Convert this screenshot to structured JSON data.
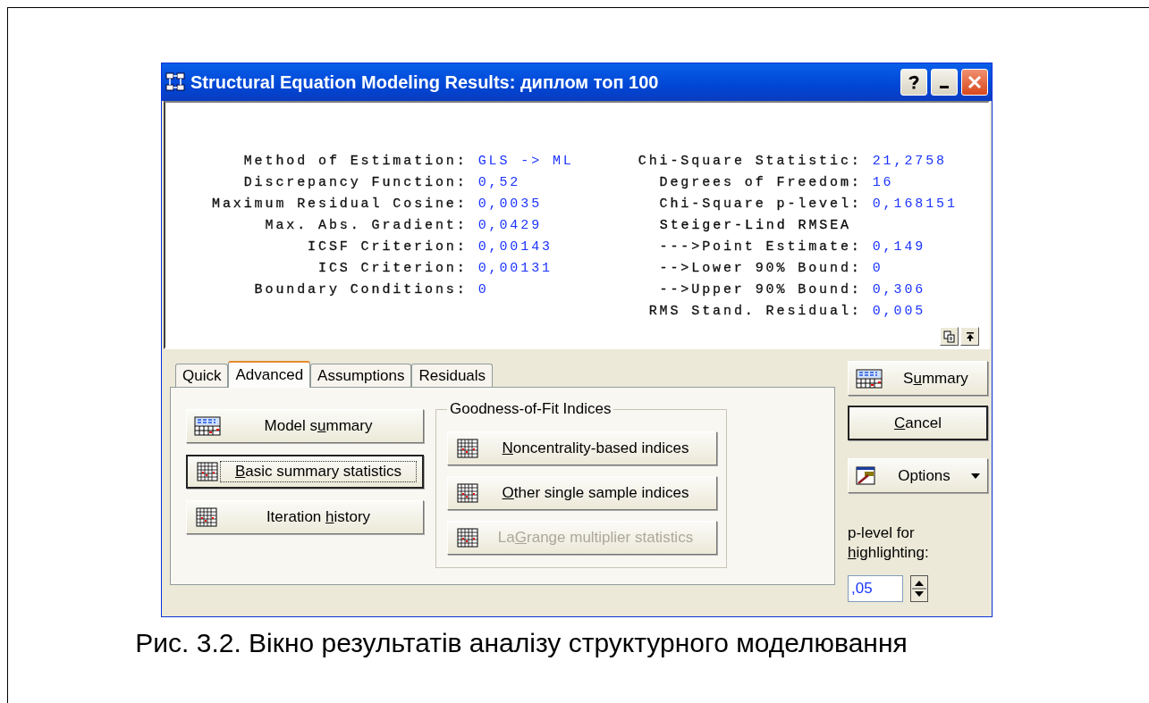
{
  "window": {
    "title": "Structural Equation Modeling Results: диплом топ 100"
  },
  "results": {
    "left": [
      {
        "kind": "row",
        "label": "Method of Estimation:",
        "value": "GLS -> ML"
      },
      {
        "kind": "row",
        "label": "Discrepancy Function:",
        "value": "0,52"
      },
      {
        "kind": "row",
        "label": "Maximum Residual Cosine:",
        "value": "0,0035"
      },
      {
        "kind": "row",
        "label": "Max. Abs. Gradient:",
        "value": "0,0429"
      },
      {
        "kind": "row",
        "label": "ICSF Criterion:",
        "value": "0,00143"
      },
      {
        "kind": "row",
        "label": "ICS Criterion:",
        "value": "0,00131"
      },
      {
        "kind": "row",
        "label": "Boundary Conditions:",
        "value": "0"
      }
    ],
    "right": [
      {
        "kind": "row",
        "label": "Chi-Square Statistic:",
        "value": "21,2758"
      },
      {
        "kind": "row",
        "label": "Degrees of Freedom:",
        "value": "16"
      },
      {
        "kind": "row",
        "label": "Chi-Square p-level:",
        "value": "0,168151"
      },
      {
        "kind": "heading",
        "label": "Steiger-Lind RMSEA"
      },
      {
        "kind": "row",
        "label": "--->Point Estimate:",
        "value": "0,149"
      },
      {
        "kind": "row",
        "label": "-->Lower 90% Bound:",
        "value": "0"
      },
      {
        "kind": "row",
        "label": "-->Upper 90% Bound:",
        "value": "0,306"
      },
      {
        "kind": "row",
        "label": "RMS Stand. Residual:",
        "value": "0,005"
      }
    ]
  },
  "tabs": [
    {
      "label": "Quick",
      "selected": false
    },
    {
      "label": "Advanced",
      "selected": true
    },
    {
      "label": "Assumptions",
      "selected": false
    },
    {
      "label": "Residuals",
      "selected": false
    }
  ],
  "action_buttons": [
    {
      "kind": "summary",
      "label": {
        "before": "Model s",
        "key": "u",
        "after": "mmary"
      },
      "focused": false
    },
    {
      "kind": "table",
      "label": {
        "key": "B",
        "after": "asic summary statistics"
      },
      "focused": true
    },
    {
      "kind": "table",
      "label": {
        "before": "Iteration ",
        "key": "h",
        "after": "istory"
      },
      "focused": false
    }
  ],
  "goodness_of_fit": {
    "title": "Goodness-of-Fit Indices",
    "buttons": [
      {
        "label": {
          "key": "N",
          "after": "oncentrality-based indices"
        },
        "disabled": false
      },
      {
        "label": {
          "key": "O",
          "after": "ther single sample indices"
        },
        "disabled": false
      },
      {
        "label": {
          "before": "La",
          "key": "G",
          "after": "range multiplier statistics"
        },
        "disabled": true
      }
    ]
  },
  "side_buttons": [
    {
      "kind": "summary",
      "label": {
        "before": "S",
        "key": "u",
        "after": "mmary"
      }
    },
    {
      "kind": "cancel",
      "label": {
        "key": "C",
        "after": "ancel"
      }
    },
    {
      "kind": "options",
      "label": {
        "before": "Options"
      }
    }
  ],
  "p_level": {
    "label": {
      "before": "p-level for ",
      "key": "h",
      "after": "ighlighting:"
    },
    "value": ",05"
  },
  "caption": "Рис. 3.2. Вікно результатів аналізу структурного моделювання"
}
